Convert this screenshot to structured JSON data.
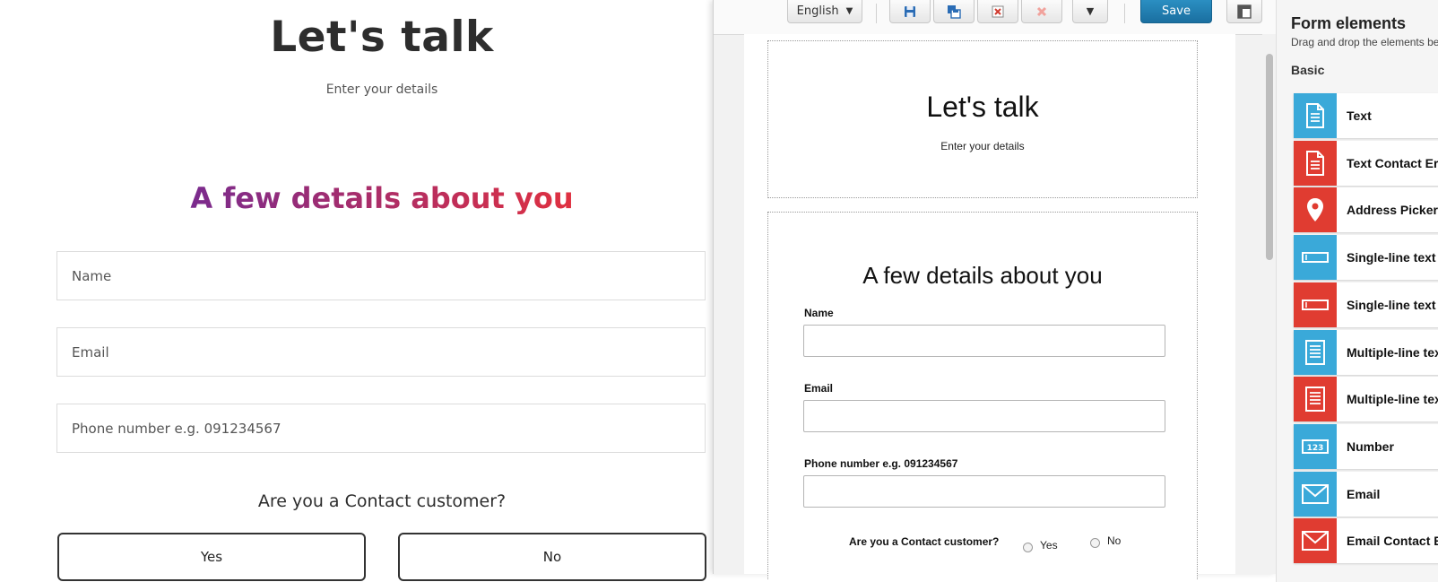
{
  "preview": {
    "title": "Let's talk",
    "subtitle": "Enter your details",
    "section_title": "A few details about you",
    "fields": {
      "name_placeholder": "Name",
      "email_placeholder": "Email",
      "phone_placeholder": "Phone number e.g. 091234567"
    },
    "question": "Are you a Contact customer?",
    "yes_label": "Yes",
    "no_label": "No"
  },
  "toolbar": {
    "language": "English",
    "save_label": "Save",
    "icons": [
      "save-icon",
      "save-as-icon",
      "delete-form-icon",
      "close-icon",
      "more-dropdown-icon",
      "layout-icon"
    ]
  },
  "editor": {
    "header_title": "Let's talk",
    "header_subtitle": "Enter your details",
    "section_title": "A few details about you",
    "name_label": "Name",
    "email_label": "Email",
    "phone_label": "Phone number e.g. 091234567",
    "question": "Are you a Contact customer?",
    "yes_label": "Yes",
    "no_label": "No"
  },
  "panel": {
    "title": "Form elements",
    "description": "Drag and drop the elements be",
    "group": "Basic",
    "items": [
      {
        "label": "Text",
        "color": "#3aa9d9",
        "icon": "text-document-icon"
      },
      {
        "label": "Text Contact Er",
        "color": "#e03c31",
        "icon": "text-document-icon"
      },
      {
        "label": "Address Picker",
        "color": "#e03c31",
        "icon": "map-pin-icon"
      },
      {
        "label": "Single-line text",
        "color": "#3aa9d9",
        "icon": "single-line-icon"
      },
      {
        "label": "Single-line text",
        "color": "#e03c31",
        "icon": "single-line-icon"
      },
      {
        "label": "Multiple-line tex",
        "color": "#3aa9d9",
        "icon": "multi-line-icon"
      },
      {
        "label": "Multiple-line tex",
        "color": "#e03c31",
        "icon": "multi-line-icon"
      },
      {
        "label": "Number",
        "color": "#3aa9d9",
        "icon": "number-icon"
      },
      {
        "label": "Email",
        "color": "#3aa9d9",
        "icon": "envelope-icon"
      },
      {
        "label": "Email Contact E",
        "color": "#e03c31",
        "icon": "envelope-icon"
      }
    ]
  },
  "colors": {
    "gradient_start": "#7a2b8e",
    "gradient_end": "#e03040",
    "save_button": "#1f7db3",
    "blue_icon": "#3aa9d9",
    "red_icon": "#e03c31"
  }
}
